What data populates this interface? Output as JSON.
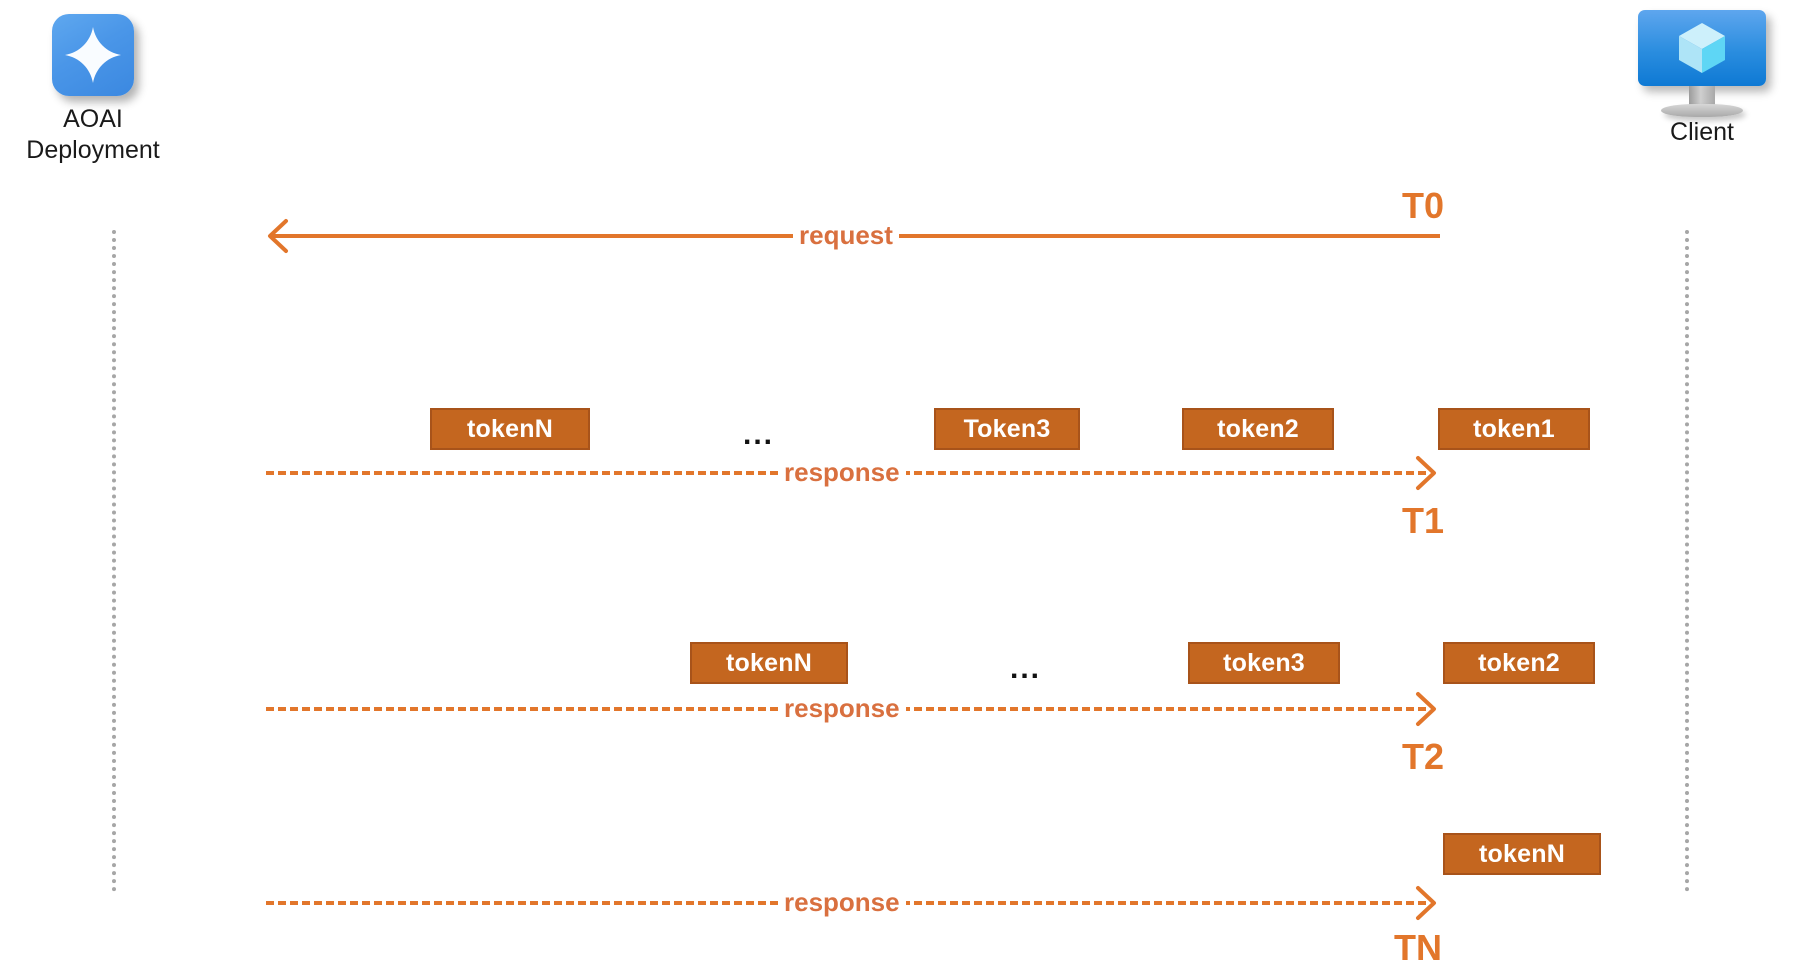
{
  "actors": [
    {
      "id": "aoai",
      "label": "AOAI\nDeployment",
      "icon": "sparkle-icon"
    },
    {
      "id": "client",
      "label": "Client",
      "icon": "monitor-cube-icon"
    }
  ],
  "colors": {
    "accent_orange": "#e2762b",
    "token_fill": "#c4661f",
    "token_border": "#a8531a",
    "lifeline_gray": "#a6a6a6",
    "icon_blue": "#3b88e0"
  },
  "messages": [
    {
      "id": "request",
      "label": "request",
      "style": "solid",
      "direction": "left"
    },
    {
      "id": "response1",
      "label": "response",
      "style": "dashed",
      "direction": "right"
    },
    {
      "id": "response2",
      "label": "response",
      "style": "dashed",
      "direction": "right"
    },
    {
      "id": "response3",
      "label": "response",
      "style": "dashed",
      "direction": "right"
    }
  ],
  "time_markers": [
    {
      "id": "t0",
      "label": "T0"
    },
    {
      "id": "t1",
      "label": "T1"
    },
    {
      "id": "t2",
      "label": "T2"
    },
    {
      "id": "tn",
      "label": "TN"
    }
  ],
  "token_rows": [
    {
      "row": 1,
      "tokens": [
        "tokenN",
        "...",
        "Token3",
        "token2",
        "token1"
      ]
    },
    {
      "row": 2,
      "tokens": [
        "tokenN",
        "...",
        "token3",
        "token2"
      ]
    },
    {
      "row": 3,
      "tokens": [
        "tokenN"
      ]
    }
  ],
  "tokens_flat": {
    "r1_t0": "tokenN",
    "r1_e": "...",
    "r1_t2": "Token3",
    "r1_t3": "token2",
    "r1_t4": "token1",
    "r2_t0": "tokenN",
    "r2_e": "...",
    "r2_t2": "token3",
    "r2_t3": "token2",
    "r3_t0": "tokenN"
  }
}
